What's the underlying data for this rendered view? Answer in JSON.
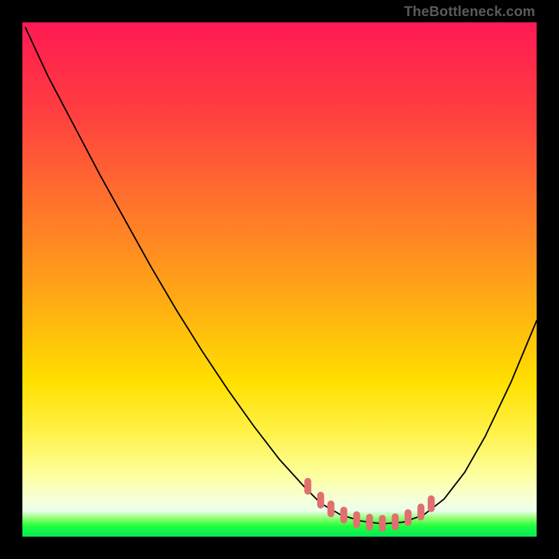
{
  "attribution": "TheBottleneck.com",
  "colors": {
    "frame": "#000000",
    "curve": "#000000",
    "marker": "#e26f6f",
    "gradient_top": "#ff1a55",
    "gradient_bottom": "#07e85a"
  },
  "chart_data": {
    "type": "line",
    "title": "",
    "xlabel": "",
    "ylabel": "",
    "xlim": [
      0,
      100
    ],
    "ylim": [
      0,
      100
    ],
    "grid": false,
    "legend": false,
    "note": "Axes have no tick labels in the source image; x/y are read as 0–100 % of the plot area (x left→right, y bottom→top). Curve values are visual estimates.",
    "series": [
      {
        "name": "curve",
        "color": "#000000",
        "x": [
          0.6,
          5,
          10,
          15,
          20,
          25,
          30,
          35,
          40,
          45,
          50,
          55,
          58,
          62,
          66,
          70,
          74,
          78,
          82,
          86,
          90,
          95,
          100
        ],
        "y": [
          99,
          89.5,
          80,
          70.5,
          61.5,
          52.5,
          44,
          36,
          28.5,
          21.5,
          15,
          9.5,
          6.5,
          4.2,
          3.0,
          2.5,
          2.8,
          4.2,
          7.3,
          12.5,
          19.5,
          30,
          42
        ]
      }
    ],
    "markers": {
      "name": "bottom-flat-markers",
      "color": "#e26f6f",
      "stroke_width_px": 10,
      "points_xy": [
        [
          55.5,
          9.8
        ],
        [
          58.0,
          7.1
        ],
        [
          60.0,
          5.4
        ],
        [
          62.5,
          4.2
        ],
        [
          65.0,
          3.3
        ],
        [
          67.5,
          2.8
        ],
        [
          70.0,
          2.6
        ],
        [
          72.5,
          2.9
        ],
        [
          75.0,
          3.7
        ],
        [
          77.5,
          4.8
        ],
        [
          79.5,
          6.4
        ]
      ]
    }
  }
}
